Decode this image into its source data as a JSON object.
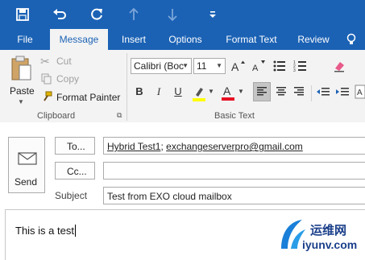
{
  "qat": {
    "icons": [
      "save-icon",
      "undo-icon",
      "redo-icon",
      "up-arrow-icon",
      "down-arrow-icon",
      "customize-icon"
    ]
  },
  "tabs": [
    {
      "label": "File"
    },
    {
      "label": "Message"
    },
    {
      "label": "Insert"
    },
    {
      "label": "Options"
    },
    {
      "label": "Format Text"
    },
    {
      "label": "Review"
    }
  ],
  "ribbon": {
    "paste_label": "Paste",
    "cut_label": "Cut",
    "copy_label": "Copy",
    "format_painter_label": "Format Painter",
    "clipboard_group": "Clipboard",
    "font_name": "Calibri (Boc",
    "font_size": "11",
    "basic_text_group": "Basic Text",
    "bold": "B",
    "italic": "I",
    "underline": "U",
    "font_color_letter": "A",
    "colors": {
      "highlight": "#ffff00",
      "font": "#e81123",
      "accent": "#1b62b5"
    }
  },
  "message": {
    "send_label": "Send",
    "to_label": "To...",
    "cc_label": "Cc...",
    "subject_label": "Subject",
    "to_value_1": "Hybrid Test1",
    "to_sep": "; ",
    "to_value_2": "exchangeserverpro@gmail.com",
    "cc_value": "",
    "subject_value": "Test from EXO cloud mailbox",
    "body_text": "This is a test"
  },
  "watermark": {
    "text_cn": "运维网",
    "text_url": "iyunv.com"
  }
}
